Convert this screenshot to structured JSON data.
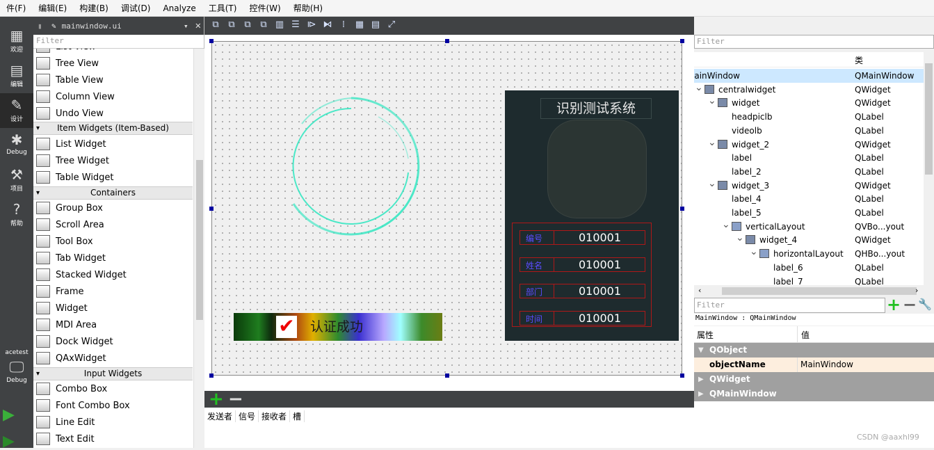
{
  "menubar": [
    "件(F)",
    "编辑(E)",
    "构建(B)",
    "调试(D)",
    "Analyze",
    "工具(T)",
    "控件(W)",
    "帮助(H)"
  ],
  "modes": [
    {
      "label": "欢迎",
      "icon": "grid-icon"
    },
    {
      "label": "编辑",
      "icon": "document-icon"
    },
    {
      "label": "设计",
      "icon": "pencil-icon"
    },
    {
      "label": "Debug",
      "icon": "bug-icon"
    },
    {
      "label": "项目",
      "icon": "wrench-icon"
    },
    {
      "label": "帮助",
      "icon": "help-icon"
    }
  ],
  "kit": {
    "name": "acetest",
    "mode": "Debug"
  },
  "widgetbox": {
    "file": "mainwindow.ui",
    "filter_placeholder": "Filter",
    "partial_item": "List View",
    "items_top": [
      "Tree View",
      "Table View",
      "Column View",
      "Undo View"
    ],
    "cat_item_widgets": "Item Widgets (Item-Based)",
    "item_widgets": [
      "List Widget",
      "Tree Widget",
      "Table Widget"
    ],
    "cat_containers": "Containers",
    "containers": [
      "Group Box",
      "Scroll Area",
      "Tool Box",
      "Tab Widget",
      "Stacked Widget",
      "Frame",
      "Widget",
      "MDI Area",
      "Dock Widget",
      "QAxWidget"
    ],
    "cat_input": "Input Widgets",
    "inputs": [
      "Combo Box",
      "Font Combo Box",
      "Line Edit",
      "Text Edit"
    ]
  },
  "form": {
    "title": "识别测试系统",
    "fields": [
      {
        "label": "编号",
        "value": "010001"
      },
      {
        "label": "姓名",
        "value": "010001"
      },
      {
        "label": "部门",
        "value": "010001"
      },
      {
        "label": "时间",
        "value": "010001"
      }
    ],
    "auth_text": "认证成功",
    "ring_color": "#2ee6c0"
  },
  "signals": {
    "headers": [
      "发送者",
      "信号",
      "接收者",
      "槽"
    ]
  },
  "object_inspector": {
    "filter_placeholder": "Filter",
    "class_header": "类",
    "rows": [
      {
        "name": "MainWindow",
        "cls": "QMainWindow",
        "depth": 0
      },
      {
        "name": "centralwidget",
        "cls": "QWidget",
        "depth": 1
      },
      {
        "name": "widget",
        "cls": "QWidget",
        "depth": 2
      },
      {
        "name": "headpiclb",
        "cls": "QLabel",
        "depth": 3
      },
      {
        "name": "videolb",
        "cls": "QLabel",
        "depth": 3
      },
      {
        "name": "widget_2",
        "cls": "QWidget",
        "depth": 2
      },
      {
        "name": "label",
        "cls": "QLabel",
        "depth": 3
      },
      {
        "name": "label_2",
        "cls": "QLabel",
        "depth": 3
      },
      {
        "name": "widget_3",
        "cls": "QWidget",
        "depth": 2
      },
      {
        "name": "label_4",
        "cls": "QLabel",
        "depth": 3
      },
      {
        "name": "label_5",
        "cls": "QLabel",
        "depth": 3
      },
      {
        "name": "verticalLayout",
        "cls": "QVBo...yout",
        "depth": 3
      },
      {
        "name": "widget_4",
        "cls": "QWidget",
        "depth": 4
      },
      {
        "name": "horizontalLayout",
        "cls": "QHBo...yout",
        "depth": 5
      },
      {
        "name": "label_6",
        "cls": "QLabel",
        "depth": 6
      },
      {
        "name": "label_7",
        "cls": "QLabel",
        "depth": 6
      }
    ]
  },
  "property_editor": {
    "filter_placeholder": "Filter",
    "object_class": "MainWindow : QMainWindow",
    "col_property": "属性",
    "col_value": "值",
    "sections": [
      "QObject",
      "QWidget",
      "QMainWindow"
    ],
    "object_name_key": "objectName",
    "object_name_value": "MainWindow"
  },
  "watermark": "CSDN @aaxhl99"
}
